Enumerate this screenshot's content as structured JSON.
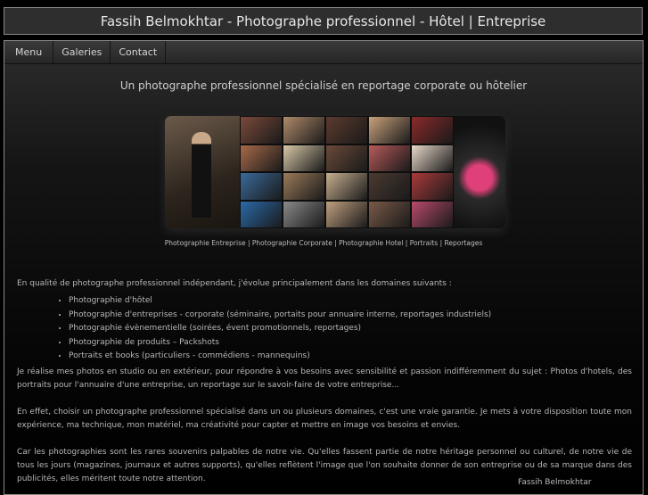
{
  "header": {
    "title": "Fassih Belmokhtar - Photographe professionnel - Hôtel | Entreprise"
  },
  "menu": [
    {
      "label": "Menu"
    },
    {
      "label": "Galeries"
    },
    {
      "label": "Contact"
    }
  ],
  "tagline": "Un photographe professionnel spécialisé en reportage corporate ou hôtelier",
  "banner_caption": "Photographie Entreprise | Photographie Corporate | Photographie Hotel | Portraits | Reportages",
  "intro": "En qualité de photographe professionnel indépendant, j'évolue principalement dans les domaines suivants :",
  "services": [
    "Photographie d'hôtel",
    "Photographie d'entreprises - corporate (séminaire, portaits pour annuaire interne, reportages industriels)",
    "Photographie évènementielle (soirées, évent promotionnels, reportages)",
    "Photographie de produits – Packshots",
    "Portraits et books (particuliers - commédiens - mannequins)"
  ],
  "paragraphs": [
    "Je réalise mes photos en studio ou en extérieur, pour répondre à vos besoins avec sensibilité et passion indifféremment du sujet : Photos d'hotels, des portraits pour l'annuaire d'une entreprise, un reportage sur le savoir-faire de votre entreprise...",
    "En effet, choisir un photographe professionnel spécialisé dans un ou plusieurs domaines, c'est une vraie garantie. Je mets à votre disposition toute mon expérience, ma technique, mon matériel, ma créativité pour capter et mettre en image vos besoins et envies.",
    "Car les photographies sont les rares souvenirs palpables de notre vie. Qu'elles fassent partie de notre héritage personnel ou culturel, de notre vie de tous les jours (magazines, journaux et autres supports), qu'elles reflètent l'image que l'on souhaite donner de son entreprise ou de sa marque dans des publicités, elles méritent toute notre attention."
  ],
  "signature": "Fassih Belmokhtar",
  "mosaic_colors": [
    "#7a4a3a",
    "#b08a6a",
    "#5c3b2e",
    "#c9a27c",
    "#8b2a2a",
    "#a86a4a",
    "#d8c8a8",
    "#6a4a38",
    "#b85a5a",
    "#e8d8c8",
    "#3a6a9a",
    "#9a7a5a",
    "#c8b090",
    "#4a3a30",
    "#aa3a3a",
    "#2a6aaa",
    "#8a8a8a",
    "#c0a080",
    "#7a5a48",
    "#b84a6a"
  ]
}
